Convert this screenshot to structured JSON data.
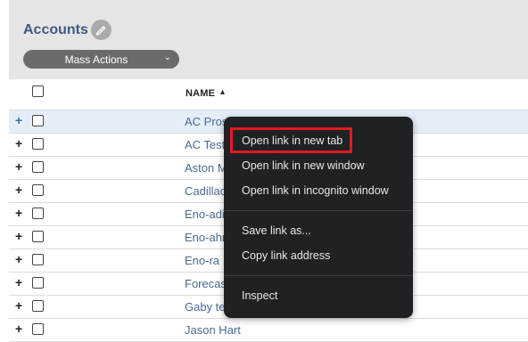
{
  "header": {
    "title": "Accounts",
    "mass_actions_label": "Mass Actions"
  },
  "table": {
    "column_name": "NAME",
    "rows": [
      {
        "name": "AC Pros"
      },
      {
        "name": "AC Test"
      },
      {
        "name": "Aston M"
      },
      {
        "name": "Cadillac"
      },
      {
        "name": "Eno-adi"
      },
      {
        "name": "Eno-ahr"
      },
      {
        "name": "Eno-ra"
      },
      {
        "name": "Forecas"
      },
      {
        "name": "Gaby te"
      },
      {
        "name": "Jason Hart"
      }
    ]
  },
  "context_menu": {
    "open_new_tab": "Open link in new tab",
    "open_new_window": "Open link in new window",
    "open_incognito": "Open link in incognito window",
    "save_link": "Save link as...",
    "copy_link": "Copy link address",
    "inspect": "Inspect"
  },
  "colors": {
    "accent": "#3b5b85",
    "highlight_row": "#e4eef8",
    "menu_bg": "#202124",
    "highlight_border": "#e01b1b"
  }
}
